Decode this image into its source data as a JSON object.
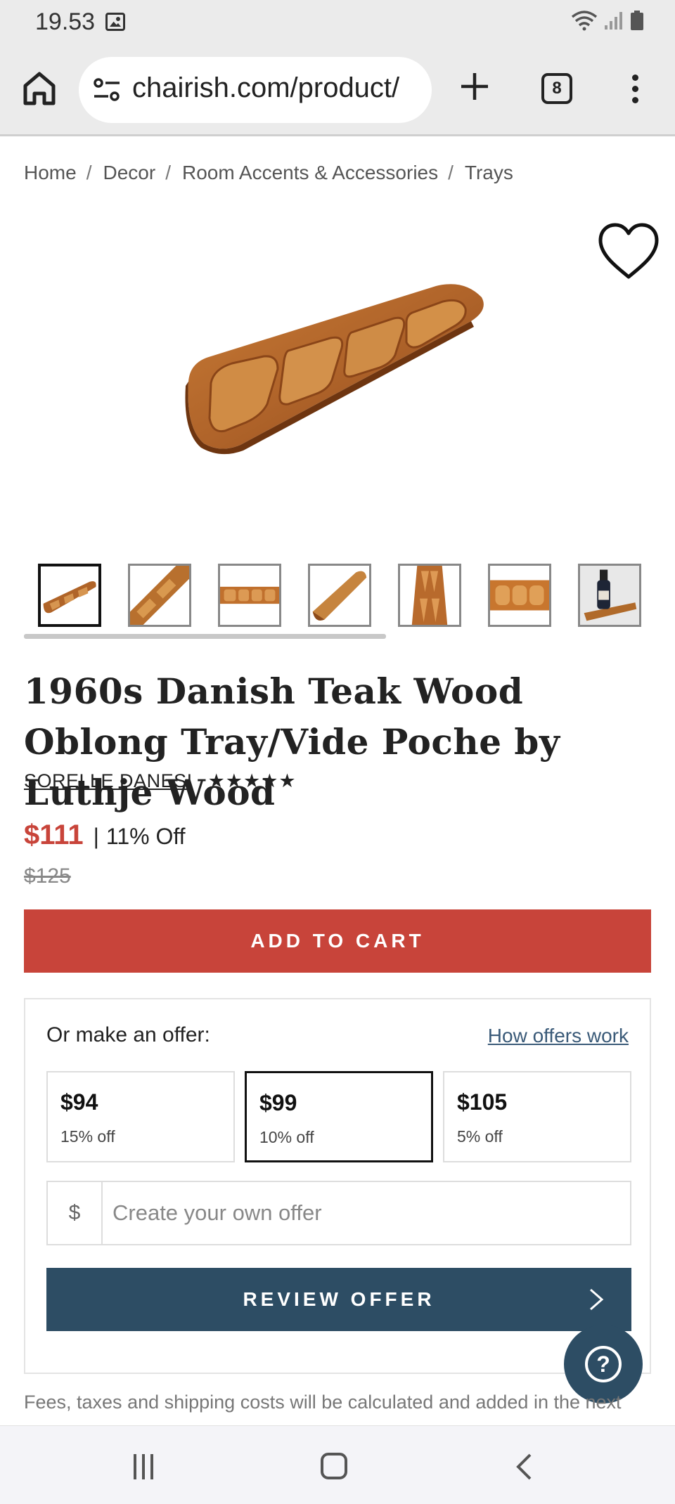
{
  "status_bar": {
    "time": "19.53"
  },
  "browser": {
    "url": "chairish.com/product/",
    "tab_count": "8"
  },
  "breadcrumb": [
    "Home",
    "Decor",
    "Room Accents & Accessories",
    "Trays"
  ],
  "breadcrumb_separator": "/",
  "product": {
    "title": "1960s Danish Teak Wood Oblong Tray/Vide Poche by Luthje Wood",
    "seller": "SORELLE DANESI",
    "rating_stars": "★★★★★",
    "rating": 5,
    "price": "$111",
    "price_separator": "|",
    "discount": "11% Off",
    "original_price": "$125",
    "thumbnail_count": 7,
    "selected_thumbnail": 1
  },
  "cart": {
    "add_to_cart_label": "ADD TO CART"
  },
  "offer": {
    "heading": "Or make an offer:",
    "how_link": "How offers work",
    "options": [
      {
        "amount": "$94",
        "pct": "15% off"
      },
      {
        "amount": "$99",
        "pct": "10% off"
      },
      {
        "amount": "$105",
        "pct": "5% off"
      }
    ],
    "selected_option": 1,
    "currency_symbol": "$",
    "custom_placeholder": "Create your own offer",
    "review_label": "REVIEW OFFER"
  },
  "help": {
    "label": "?"
  },
  "fees_note": "Fees, taxes and shipping costs will be calculated and added in the next",
  "colors": {
    "accent_red": "#c8443a",
    "navy": "#2d4d64",
    "teak": "#b5682a"
  }
}
